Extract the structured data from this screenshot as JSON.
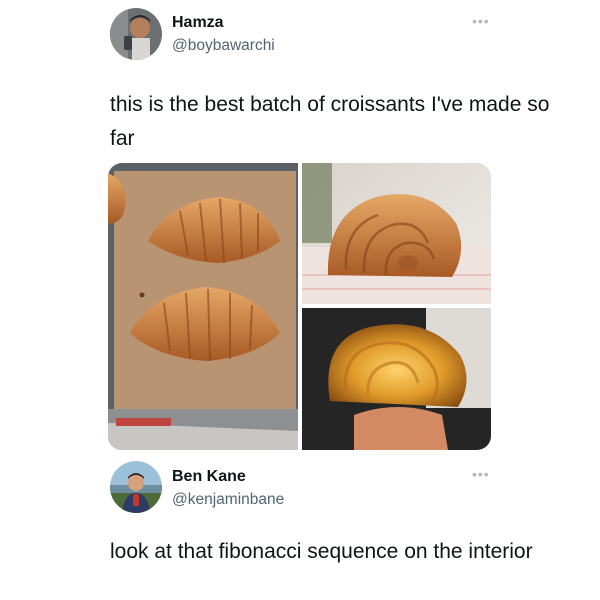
{
  "tweet": {
    "author_name": "Hamza",
    "author_handle": "@boybawarchi",
    "more_icon": "more-horizontal-icon",
    "text": "this is the best batch of croissants I've made so far",
    "media": [
      {
        "name": "croissants-on-baking-tray"
      },
      {
        "name": "croissant-side-view"
      },
      {
        "name": "croissant-backlit-cross-section"
      }
    ]
  },
  "reply": {
    "author_name": "Ben Kane",
    "author_handle": "@kenjaminbane",
    "more_icon": "more-horizontal-icon",
    "text": "look at that fibonacci sequence on the interior"
  }
}
